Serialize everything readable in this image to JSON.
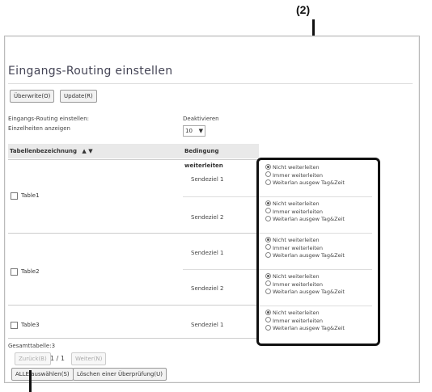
{
  "callout": "(2)",
  "page_title": "Eingangs-Routing einstellen",
  "top_buttons": {
    "overwrite": "Überwrite(O)",
    "update": "Update(R)"
  },
  "settings": {
    "routing_label": "Eingangs-Routing einstellen:",
    "routing_value": "Deaktivieren",
    "items_label": "Einzelheiten anzeigen",
    "items_value": "10"
  },
  "table": {
    "col_name": "Tabellenbezeichnung",
    "sort_glyph": "▲ ▼",
    "col_condition": "Bedingung weiterleiten",
    "rows": [
      {
        "name": "Table1",
        "dests": [
          "Sendeziel 1",
          "Sendeziel 2"
        ]
      },
      {
        "name": "Table2",
        "dests": [
          "Sendeziel 1",
          "Sendeziel 2"
        ]
      },
      {
        "name": "Table3",
        "dests": [
          "Sendeziel 1"
        ]
      }
    ]
  },
  "radio_options": [
    "Nicht weiterleiten",
    "Immer weiterleiten",
    "Weiterlan ausgew Tag&Zeit"
  ],
  "radio_groups": [
    {
      "selected": 0
    },
    {
      "selected": 0
    },
    {
      "selected": 0
    },
    {
      "selected": 0
    },
    {
      "selected": 0
    }
  ],
  "footer": {
    "total_label": "Gesamttabelle:3",
    "prev": "Zurück(B)",
    "page": "1 / 1",
    "next": "Weiter(N)",
    "select_all": "ALLE auswählen(S)",
    "clear_checked": "Löschen einer Überprüfung(U)"
  }
}
